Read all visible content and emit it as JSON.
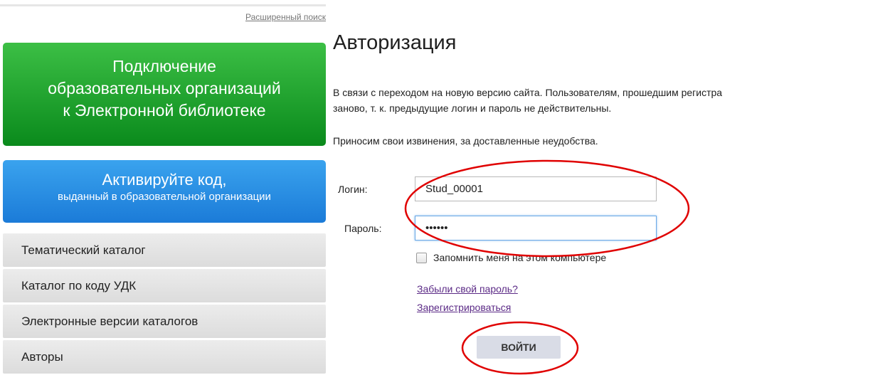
{
  "search": {
    "advanced_label": "Расширенный поиск"
  },
  "sidebar": {
    "banner_connect": {
      "lines": [
        "Подключение",
        "образовательных организаций",
        "к Электронной библиотеке"
      ]
    },
    "banner_activate": {
      "title": "Активируйте код,",
      "subtitle": "выданный в образовательной организации"
    },
    "items": [
      {
        "label": "Тематический каталог"
      },
      {
        "label": "Каталог по коду УДК"
      },
      {
        "label": "Электронные версии каталогов"
      },
      {
        "label": "Авторы"
      }
    ]
  },
  "main": {
    "title": "Авторизация",
    "notice_line1": "В связи с переходом на новую версию сайта. Пользователям, прошедшим регистра",
    "notice_line2": "заново, т. к. предыдущие логин и пароль не действительны.",
    "apology": "Приносим свои извинения, за доставленные неудобства."
  },
  "form": {
    "login_label": "Логин:",
    "login_value": "Stud_00001",
    "password_label": "Пароль:",
    "password_value": "••••••",
    "remember_label": "Запомнить меня на этом компьютере",
    "remember_checked": false,
    "forgot_link": "Забыли свой пароль?",
    "register_link": "Зарегистрироваться",
    "submit_label": "ВОЙТИ"
  },
  "colors": {
    "green_banner": "#1aa12e",
    "blue_banner": "#2a8fe6",
    "link": "#5b2a86",
    "annotation": "#e00000"
  }
}
